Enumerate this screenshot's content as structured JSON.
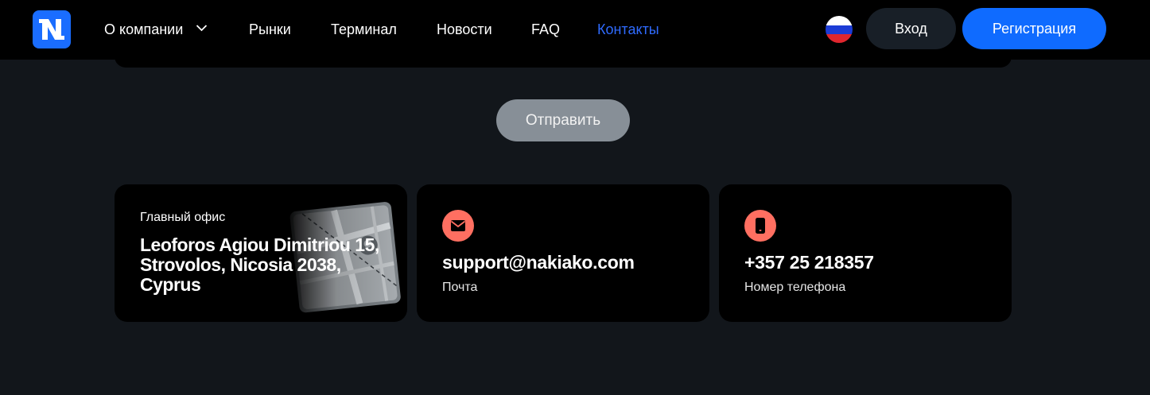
{
  "header": {
    "logo_icon": "nakiako-n-logo-icon",
    "nav": [
      {
        "label": "О компании",
        "has_dropdown": true
      },
      {
        "label": "Рынки"
      },
      {
        "label": "Терминал"
      },
      {
        "label": "Новости"
      },
      {
        "label": "FAQ"
      },
      {
        "label": "Контакты",
        "active": true
      }
    ],
    "language_icon": "russian-flag-icon",
    "login_label": "Вход",
    "register_label": "Регистрация"
  },
  "form": {
    "submit_label": "Отправить"
  },
  "contacts": {
    "office": {
      "label": "Главный офис",
      "address": "Leoforos Agiou Dimitriou 15, Strovolos, Nicosia 2038, Cyprus",
      "image_icon": "map-card-icon"
    },
    "email": {
      "icon": "mail-icon",
      "value": "support@nakiako.com",
      "caption": "Почта"
    },
    "phone": {
      "icon": "phone-icon",
      "value": "+357 25 218357",
      "caption": "Номер телефона"
    }
  },
  "colors": {
    "accent": "#0f6bff",
    "active_nav": "#2f6bff",
    "icon_bg": "#ff6f61",
    "page_bg": "#12161b",
    "card_bg": "#000000",
    "send_button": "#878f97"
  }
}
